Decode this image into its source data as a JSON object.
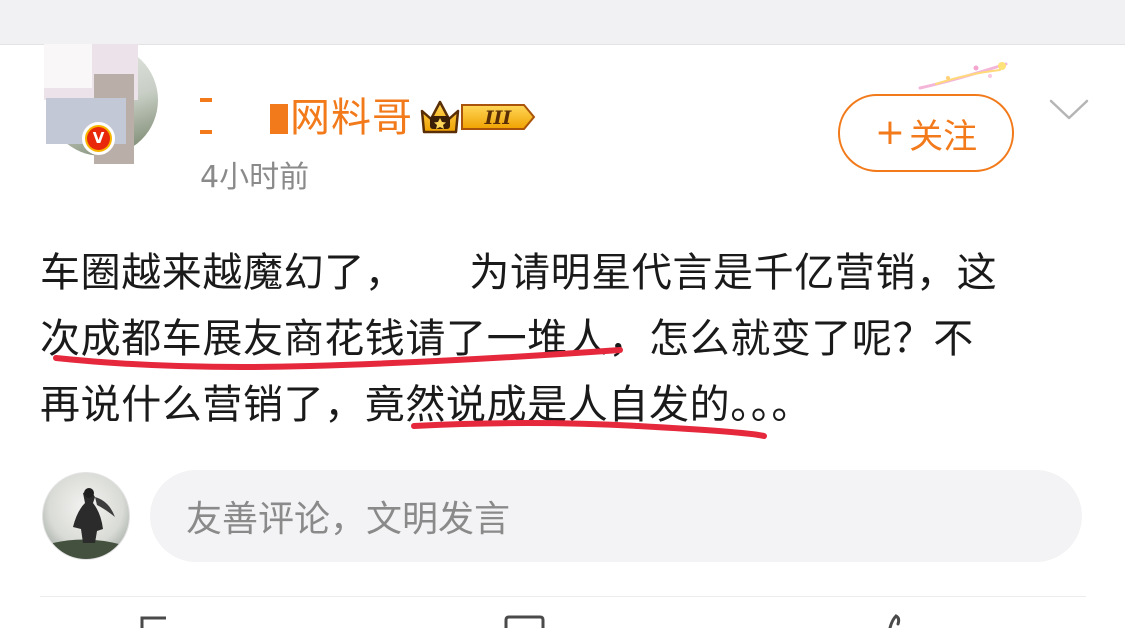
{
  "post": {
    "username": "网料哥",
    "level_badge": "III",
    "time": "4小时前",
    "verified_badge": "V",
    "follow": {
      "plus": "+",
      "label": "关注"
    },
    "text_lines": [
      {
        "before": "车圈越来越魔幻了，",
        "after": "为请明星代言是千亿营销，这"
      },
      {
        "text": "次成都车展友商花钱请了一堆人，怎么就变了呢？不"
      },
      {
        "text": "再说什么营销了，竟然说成是人自发的。。。"
      }
    ]
  },
  "comment": {
    "placeholder": "友善评论，文明发言"
  },
  "colors": {
    "accent": "#f27a1a",
    "underline": "#e6283c",
    "muted": "#8a8a8a"
  },
  "icons": [
    "chevron-down-icon",
    "crown-icon",
    "sparkle-icon"
  ]
}
